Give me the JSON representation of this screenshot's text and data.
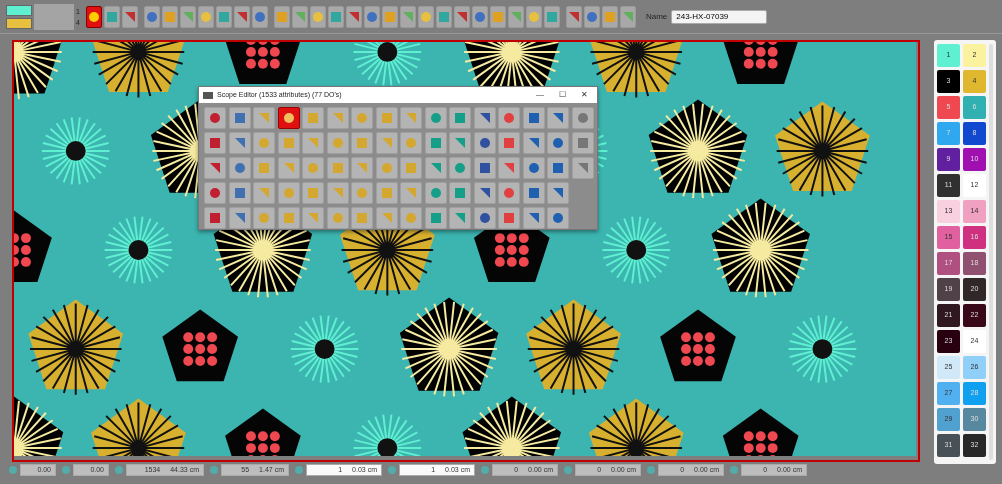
{
  "toolbar": {
    "current_colors": [
      {
        "color": "#5ef0d0"
      },
      {
        "color": "#e8c040"
      }
    ],
    "counters": [
      "1",
      "4"
    ],
    "buttons": [
      {
        "selected": true
      },
      {
        "selected": false
      },
      {
        "selected": false
      },
      {
        "selected": false
      },
      {
        "selected": false
      },
      {
        "selected": false
      },
      {
        "selected": false
      },
      {
        "selected": false
      },
      {
        "selected": false
      },
      {
        "selected": false
      },
      {
        "selected": false
      },
      {
        "selected": false
      },
      {
        "selected": false
      },
      {
        "selected": false
      },
      {
        "selected": false
      },
      {
        "selected": false
      },
      {
        "selected": false
      },
      {
        "selected": false
      },
      {
        "selected": false
      },
      {
        "selected": false
      },
      {
        "selected": false
      },
      {
        "selected": false
      },
      {
        "selected": false
      },
      {
        "selected": false
      },
      {
        "selected": false
      },
      {
        "selected": false
      },
      {
        "selected": false
      },
      {
        "selected": false
      },
      {
        "selected": false
      },
      {
        "selected": false
      }
    ],
    "name_label": "Name",
    "name_value": "243-HX-07039"
  },
  "scope_editor": {
    "title": "Scope Editor (1533 attributes) (77 DO's)",
    "controls": [
      "—",
      "☐",
      "✕"
    ],
    "tool_rows": [
      [
        {
          "selected": false
        },
        {
          "selected": false
        },
        {
          "selected": false
        },
        {
          "selected": true
        },
        {
          "selected": false
        },
        {
          "selected": false
        },
        {
          "selected": false
        },
        {
          "selected": false
        },
        {
          "selected": false
        },
        {
          "selected": false
        },
        {
          "selected": false
        },
        {
          "selected": false
        },
        {
          "selected": false
        },
        {
          "selected": false
        },
        {
          "selected": false
        },
        {
          "selected": false
        }
      ],
      [
        {
          "selected": false
        },
        {
          "selected": false
        },
        {
          "selected": false
        },
        {
          "selected": false
        },
        {
          "selected": false
        },
        {
          "selected": false
        },
        {
          "selected": false
        },
        {
          "selected": false
        },
        {
          "selected": false
        },
        {
          "selected": false
        },
        {
          "selected": false
        },
        {
          "selected": false
        },
        {
          "selected": false
        },
        {
          "selected": false
        },
        {
          "selected": false
        },
        {
          "selected": false
        }
      ],
      [
        {
          "selected": false
        },
        {
          "selected": false
        },
        {
          "selected": false
        },
        {
          "selected": false
        },
        {
          "selected": false
        },
        {
          "selected": false
        },
        {
          "selected": false
        },
        {
          "selected": false
        },
        {
          "selected": false
        },
        {
          "selected": false
        },
        {
          "selected": false
        },
        {
          "selected": false
        },
        {
          "selected": false
        },
        {
          "selected": false
        },
        {
          "selected": false
        },
        {
          "selected": false
        }
      ],
      [
        {
          "selected": false
        },
        {
          "selected": false
        },
        {
          "selected": false
        },
        {
          "selected": false
        },
        {
          "selected": false
        },
        {
          "selected": false
        },
        {
          "selected": false
        },
        {
          "selected": false
        },
        {
          "selected": false
        },
        {
          "selected": false
        },
        {
          "selected": false
        },
        {
          "selected": false
        },
        {
          "selected": false
        },
        {
          "selected": false
        },
        {
          "selected": false
        }
      ],
      [
        {
          "selected": false
        },
        {
          "selected": false
        },
        {
          "selected": false
        },
        {
          "selected": false
        },
        {
          "selected": false
        },
        {
          "selected": false
        },
        {
          "selected": false
        },
        {
          "selected": false
        },
        {
          "selected": false
        },
        {
          "selected": false
        },
        {
          "selected": false
        },
        {
          "selected": false
        },
        {
          "selected": false
        },
        {
          "selected": false
        },
        {
          "selected": false
        }
      ]
    ]
  },
  "palette": [
    {
      "number": "1",
      "color": "#5ef0d0"
    },
    {
      "number": "2",
      "color": "#fbf2a0"
    },
    {
      "number": "3",
      "color": "#000000"
    },
    {
      "number": "4",
      "color": "#e0b830"
    },
    {
      "number": "5",
      "color": "#f04850"
    },
    {
      "number": "6",
      "color": "#30b0b0"
    },
    {
      "number": "7",
      "color": "#30a8f0"
    },
    {
      "number": "8",
      "color": "#1048d0"
    },
    {
      "number": "9",
      "color": "#6020a0"
    },
    {
      "number": "10",
      "color": "#a010b0"
    },
    {
      "number": "11",
      "color": "#303030"
    },
    {
      "number": "12",
      "color": "#ffffff"
    },
    {
      "number": "13",
      "color": "#f8d0e0"
    },
    {
      "number": "14",
      "color": "#f0a0c0"
    },
    {
      "number": "15",
      "color": "#e060a0"
    },
    {
      "number": "16",
      "color": "#d03080"
    },
    {
      "number": "17",
      "color": "#b05080"
    },
    {
      "number": "18",
      "color": "#905070"
    },
    {
      "number": "19",
      "color": "#504048"
    },
    {
      "number": "20",
      "color": "#302828"
    },
    {
      "number": "21",
      "color": "#301820"
    },
    {
      "number": "22",
      "color": "#380818"
    },
    {
      "number": "23",
      "color": "#280010"
    },
    {
      "number": "24",
      "color": "#ffffff"
    },
    {
      "number": "25",
      "color": "#d0e8f8"
    },
    {
      "number": "26",
      "color": "#90d0f8"
    },
    {
      "number": "27",
      "color": "#50b0f0"
    },
    {
      "number": "28",
      "color": "#10a0f0"
    },
    {
      "number": "29",
      "color": "#50a0d0"
    },
    {
      "number": "30",
      "color": "#5888a0"
    },
    {
      "number": "31",
      "color": "#485058"
    },
    {
      "number": "32",
      "color": "#282828"
    }
  ],
  "status_fields": [
    {
      "values": [
        "0.00"
      ],
      "highlighted": false
    },
    {
      "values": [
        "0.00"
      ],
      "highlighted": false
    },
    {
      "values": [
        "1534",
        "44.33 cm"
      ],
      "highlighted": false
    },
    {
      "values": [
        "55",
        "1.47 cm"
      ],
      "highlighted": false
    },
    {
      "values": [
        "1",
        "0.03 cm"
      ],
      "highlighted": true
    },
    {
      "values": [
        "1",
        "0.03 cm"
      ],
      "highlighted": true
    },
    {
      "values": [
        "0",
        "0.00 cm"
      ],
      "highlighted": false
    },
    {
      "values": [
        "0",
        "0.00 cm"
      ],
      "highlighted": false
    },
    {
      "values": [
        "0",
        "0.00 cm"
      ],
      "highlighted": false
    },
    {
      "values": [
        "0",
        "0.00 cm"
      ],
      "highlighted": false
    }
  ]
}
